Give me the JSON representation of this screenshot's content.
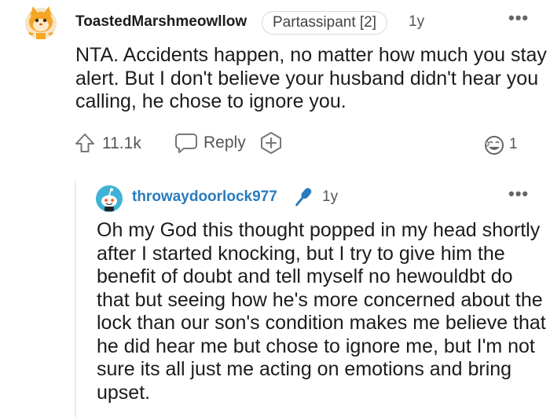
{
  "comment": {
    "username": "ToastedMarshmeowllow",
    "flair": "Partassipant [2]",
    "age": "1y",
    "more": "•••",
    "body": "NTA. Accidents happen, no matter how much you stay alert. But I don't believe your husband didn't hear you calling, he chose to ignore you.",
    "votes": "11.1k",
    "reply_label": "Reply",
    "award_count": "1",
    "icons": {
      "avatar": "orange-cat-avatar-icon",
      "upvote": "upvote-arrow-icon",
      "reply": "speech-bubble-icon",
      "award": "plus-box-icon",
      "awarded": "laughing-face-award-icon",
      "more": "more-options-icon"
    }
  },
  "reply": {
    "username": "throwaydoorlock977",
    "age": "1y",
    "more": "•••",
    "body": "Oh my God this thought popped in my head shortly after I started knocking, but I try to give him the benefit of doubt and tell myself no hewouldbt do that but seeing how he's more concerned about the lock than our son's condition makes me believe that he did hear me but chose to ignore me, but I'm not sure its all just me acting on emotions and bring upset.",
    "icons": {
      "avatar": "snoo-avatar-icon",
      "op_badge": "microphone-icon",
      "more": "more-options-icon"
    }
  },
  "colors": {
    "op_username": "#2a7bbd",
    "avatar_orange": "#f5a623",
    "avatar_blue": "#3fb3d6"
  }
}
